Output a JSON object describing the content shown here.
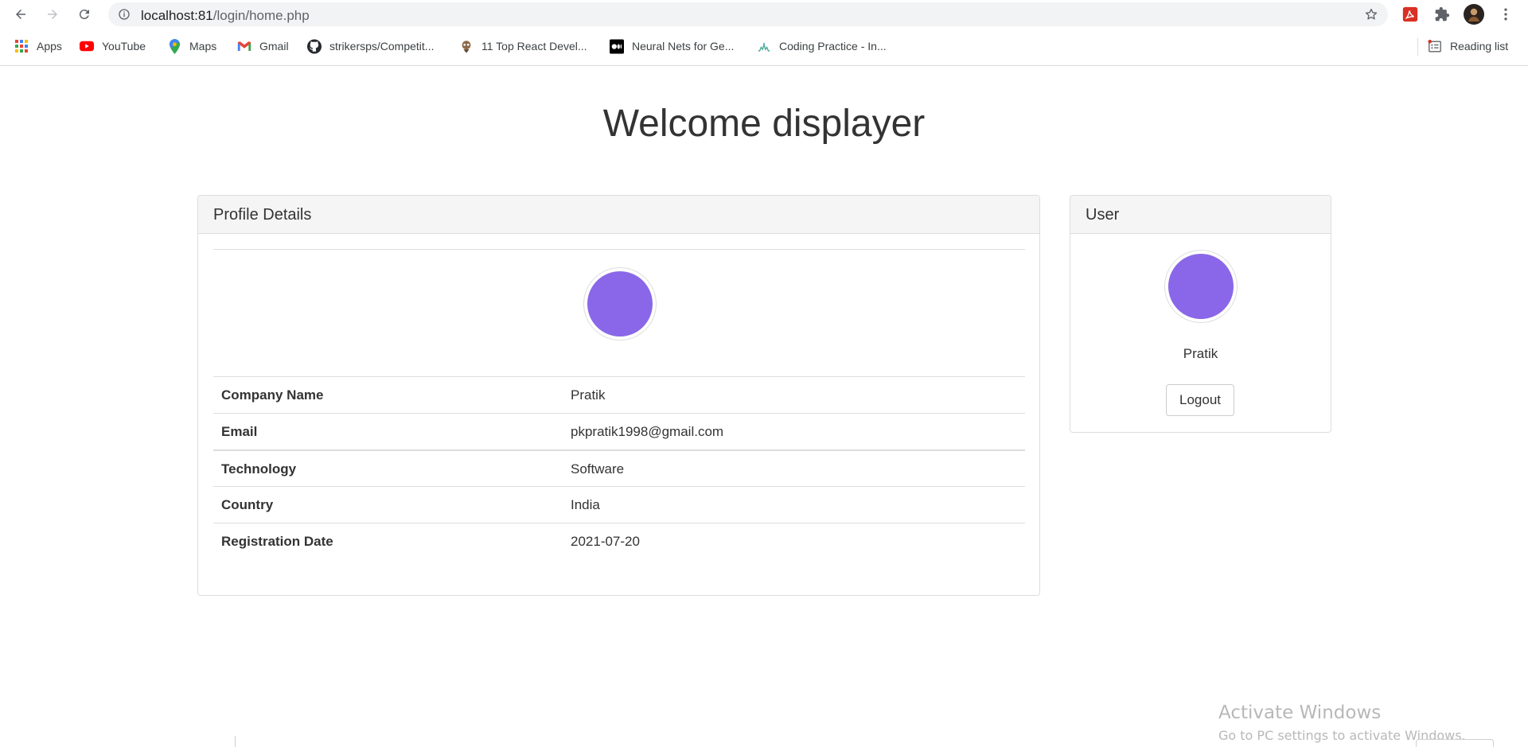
{
  "browser": {
    "url_host": "localhost:81",
    "url_path": "/login/home.php",
    "reading_list_label": "Reading list",
    "bookmarks": [
      {
        "label": "Apps",
        "icon": "apps-grid-icon"
      },
      {
        "label": "YouTube",
        "icon": "youtube-icon"
      },
      {
        "label": "Maps",
        "icon": "maps-pin-icon"
      },
      {
        "label": "Gmail",
        "icon": "gmail-icon"
      },
      {
        "label": "strikersps/Competit...",
        "icon": "github-icon"
      },
      {
        "label": "11 Top React Devel...",
        "icon": "toptal-icon"
      },
      {
        "label": "Neural Nets for Ge...",
        "icon": "medium-icon"
      },
      {
        "label": "Coding Practice - In...",
        "icon": "interviewbit-icon"
      }
    ]
  },
  "page": {
    "title": "Welcome displayer"
  },
  "profile": {
    "heading": "Profile Details",
    "rows": [
      {
        "label": "Company Name",
        "value": "Pratik"
      },
      {
        "label": "Email",
        "value": "pkpratik1998@gmail.com"
      },
      {
        "label": "Technology",
        "value": "Software"
      },
      {
        "label": "Country",
        "value": "India"
      },
      {
        "label": "Registration Date",
        "value": "2021-07-20"
      }
    ]
  },
  "user": {
    "heading": "User",
    "name": "Pratik",
    "logout_label": "Logout"
  },
  "watermark": {
    "title": "Activate Windows",
    "subtitle": "Go to PC settings to activate Windows."
  },
  "colors": {
    "avatar": "#8a67e8",
    "panel_header": "#f5f5f5",
    "border": "#dddddd"
  }
}
